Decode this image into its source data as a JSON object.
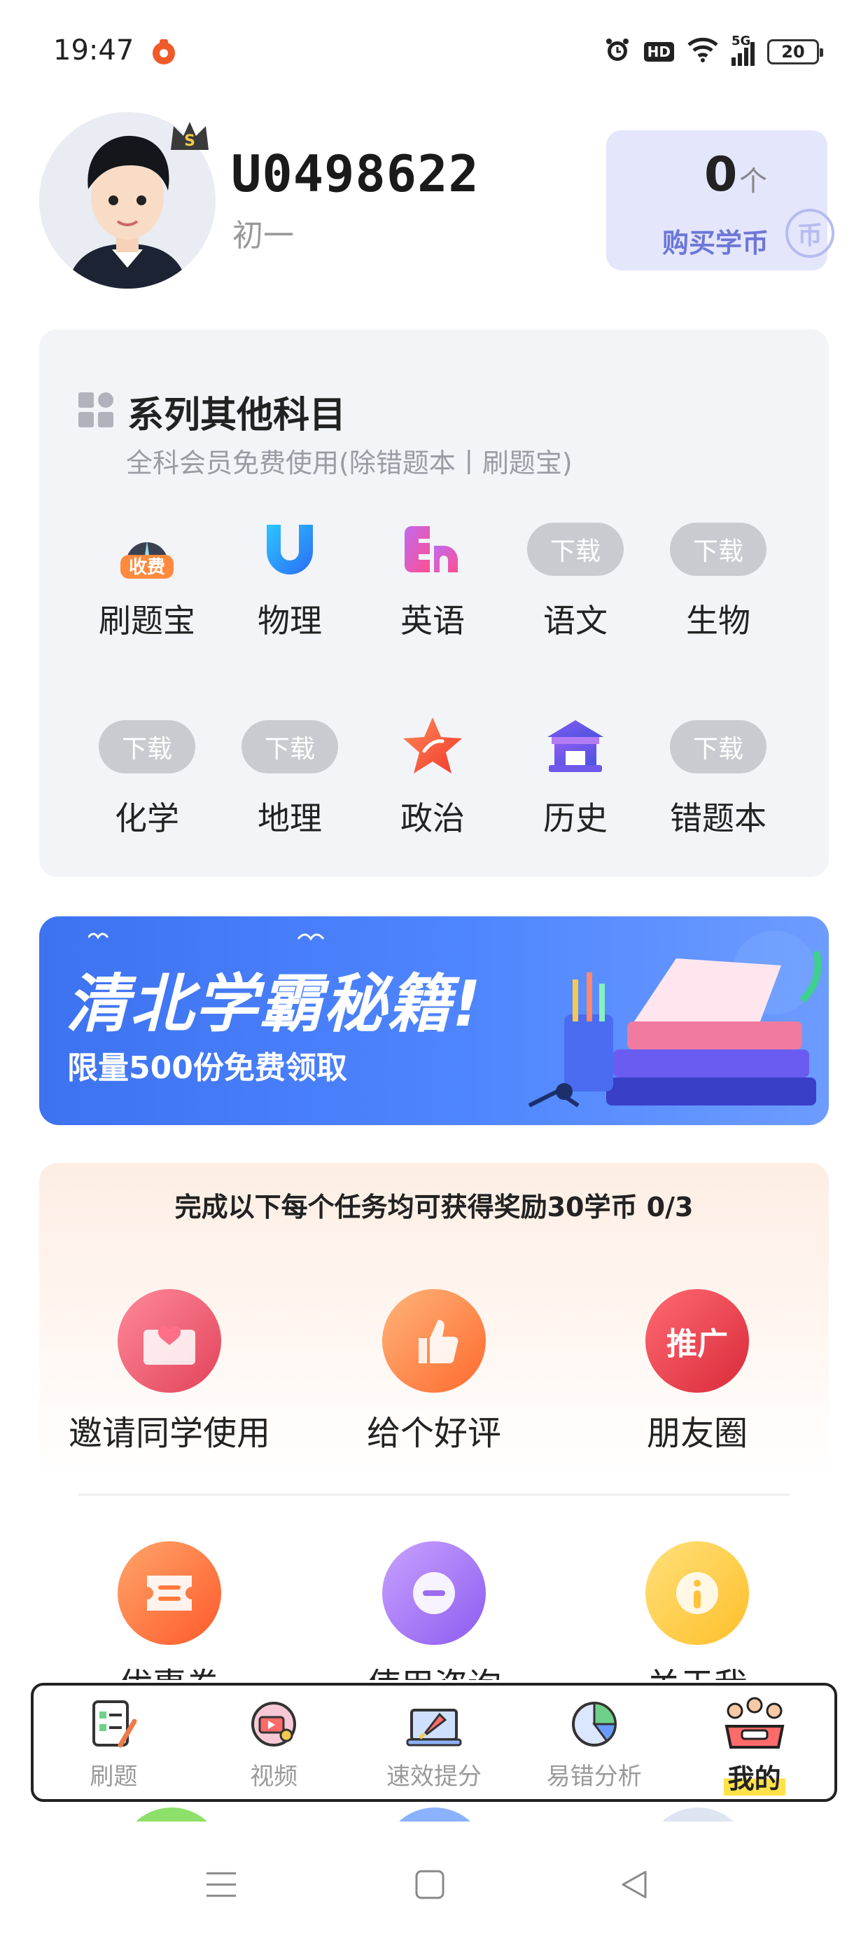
{
  "status_bar": {
    "time": "19:47",
    "network": "5G",
    "battery": "20",
    "hd": "HD"
  },
  "profile": {
    "username": "U0498622",
    "grade": "初一",
    "coins": "0",
    "coin_unit": "个",
    "buy_coins_label": "购买学币",
    "coin_icon_text": "币",
    "vip_badge": "S"
  },
  "series": {
    "title": "系列其他科目",
    "subtitle": "全科会员免费使用(除错题本丨刷题宝)",
    "paid_badge": "收费",
    "download_label": "下载",
    "items": [
      {
        "label": "刷题宝",
        "state": "paid"
      },
      {
        "label": "物理",
        "state": "installed"
      },
      {
        "label": "英语",
        "state": "installed"
      },
      {
        "label": "语文",
        "state": "download"
      },
      {
        "label": "生物",
        "state": "download"
      },
      {
        "label": "化学",
        "state": "download"
      },
      {
        "label": "地理",
        "state": "download"
      },
      {
        "label": "政治",
        "state": "installed"
      },
      {
        "label": "历史",
        "state": "installed"
      },
      {
        "label": "错题本",
        "state": "download"
      }
    ]
  },
  "banner": {
    "headline": "清北学霸秘籍!",
    "subline": "限量500份免费领取"
  },
  "tasks": {
    "title": "完成以下每个任务均可获得奖励30学币 0/3",
    "items": [
      {
        "label": "邀请同学使用",
        "icon": "envelope-heart-icon"
      },
      {
        "label": "给个好评",
        "icon": "thumbs-up-icon"
      },
      {
        "label": "朋友圈",
        "icon": "promote-icon",
        "badge": "推广"
      }
    ]
  },
  "services": {
    "items": [
      {
        "label": "优惠券",
        "icon": "coupon-icon"
      },
      {
        "label": "使用咨询",
        "icon": "chat-icon"
      },
      {
        "label": "关于我",
        "icon": "info-icon"
      }
    ]
  },
  "tabbar": {
    "items": [
      {
        "label": "刷题"
      },
      {
        "label": "视频"
      },
      {
        "label": "速效提分"
      },
      {
        "label": "易错分析"
      },
      {
        "label": "我的"
      }
    ],
    "active_index": 4
  },
  "colors": {
    "accent": "#4f7cff",
    "coin_card": "#e4e6fb",
    "panel": "#f2f4f8",
    "tab_highlight": "#ffe14a"
  }
}
